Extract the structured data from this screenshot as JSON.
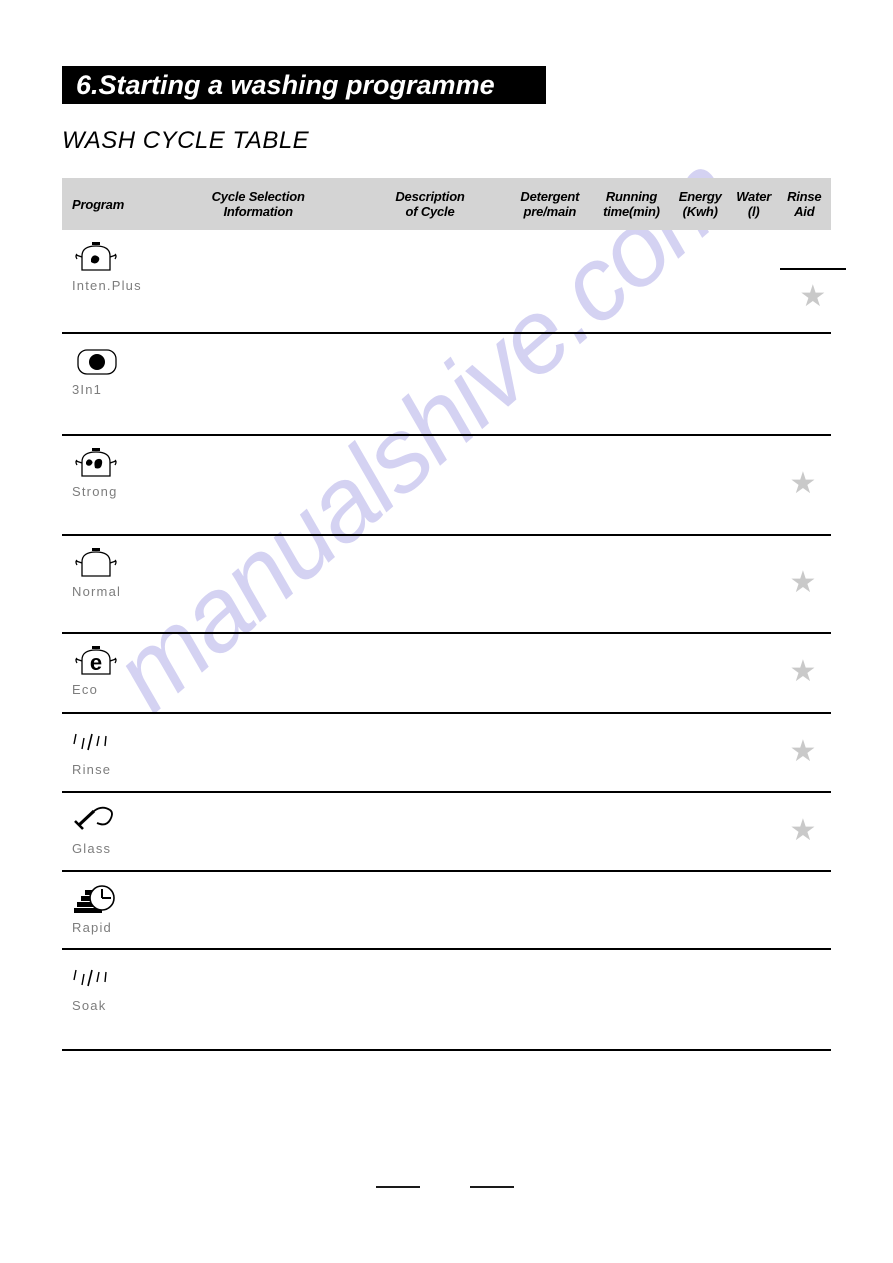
{
  "header": {
    "section_number_title": "6.Starting a washing programme",
    "subtitle": "WASH CYCLE TABLE"
  },
  "watermark": {
    "text": "manualshive.com",
    "color": "#d4d2f2"
  },
  "table": {
    "columns": [
      {
        "key": "program",
        "line1": "Program",
        "line2": ""
      },
      {
        "key": "cycle",
        "line1": "Cycle Selection",
        "line2": "Information"
      },
      {
        "key": "desc",
        "line1": "Description",
        "line2": "of Cycle"
      },
      {
        "key": "detergent",
        "line1": "Detergent",
        "line2": "pre/main"
      },
      {
        "key": "running",
        "line1": "Running",
        "line2": "time(min)"
      },
      {
        "key": "energy",
        "line1": "Energy",
        "line2": "(Kwh)"
      },
      {
        "key": "water",
        "line1": "Water",
        "line2": "(l)"
      },
      {
        "key": "rinse",
        "line1": "Rinse",
        "line2": "Aid"
      }
    ],
    "header_background": "#d4d4d4",
    "star_color": "#c9c9c9",
    "rows": [
      {
        "program": "Inten.Plus",
        "icon": "pot-single-mark-icon",
        "cycle_selection_information": "",
        "description_of_cycle": "",
        "detergent_pre_main": "",
        "running_time_min": "",
        "energy_kwh": "",
        "water_l": "",
        "rinse_aid": "star",
        "rinse_aid_has_rule": true
      },
      {
        "program": "3In1",
        "icon": "rounded-rect-dot-icon",
        "cycle_selection_information": "",
        "description_of_cycle": "",
        "detergent_pre_main": "",
        "running_time_min": "",
        "energy_kwh": "",
        "water_l": "",
        "rinse_aid": "",
        "rinse_aid_has_rule": false
      },
      {
        "program": "Strong",
        "icon": "pot-double-mark-icon",
        "cycle_selection_information": "",
        "description_of_cycle": "",
        "detergent_pre_main": "",
        "running_time_min": "",
        "energy_kwh": "",
        "water_l": "",
        "rinse_aid": "star",
        "rinse_aid_has_rule": false
      },
      {
        "program": "Normal",
        "icon": "pot-plain-icon",
        "cycle_selection_information": "",
        "description_of_cycle": "",
        "detergent_pre_main": "",
        "running_time_min": "",
        "energy_kwh": "",
        "water_l": "",
        "rinse_aid": "star",
        "rinse_aid_has_rule": false
      },
      {
        "program": "Eco",
        "icon": "pot-eco-icon",
        "cycle_selection_information": "",
        "description_of_cycle": "",
        "detergent_pre_main": "",
        "running_time_min": "",
        "energy_kwh": "",
        "water_l": "",
        "rinse_aid": "star",
        "rinse_aid_has_rule": false
      },
      {
        "program": "Rinse",
        "icon": "water-streaks-icon",
        "cycle_selection_information": "",
        "description_of_cycle": "",
        "detergent_pre_main": "",
        "running_time_min": "",
        "energy_kwh": "",
        "water_l": "",
        "rinse_aid": "star",
        "rinse_aid_has_rule": false
      },
      {
        "program": "Glass",
        "icon": "wine-glass-icon",
        "cycle_selection_information": "",
        "description_of_cycle": "",
        "detergent_pre_main": "",
        "running_time_min": "",
        "energy_kwh": "",
        "water_l": "",
        "rinse_aid": "star",
        "rinse_aid_has_rule": false
      },
      {
        "program": "Rapid",
        "icon": "fast-clock-icon",
        "cycle_selection_information": "",
        "description_of_cycle": "",
        "detergent_pre_main": "",
        "running_time_min": "",
        "energy_kwh": "",
        "water_l": "",
        "rinse_aid": "",
        "rinse_aid_has_rule": false
      },
      {
        "program": "Soak",
        "icon": "water-streaks-icon",
        "cycle_selection_information": "",
        "description_of_cycle": "",
        "detergent_pre_main": "",
        "running_time_min": "",
        "energy_kwh": "",
        "water_l": "",
        "rinse_aid": "",
        "rinse_aid_has_rule": false
      }
    ]
  },
  "footer": {
    "rule_left": "",
    "rule_right": ""
  }
}
